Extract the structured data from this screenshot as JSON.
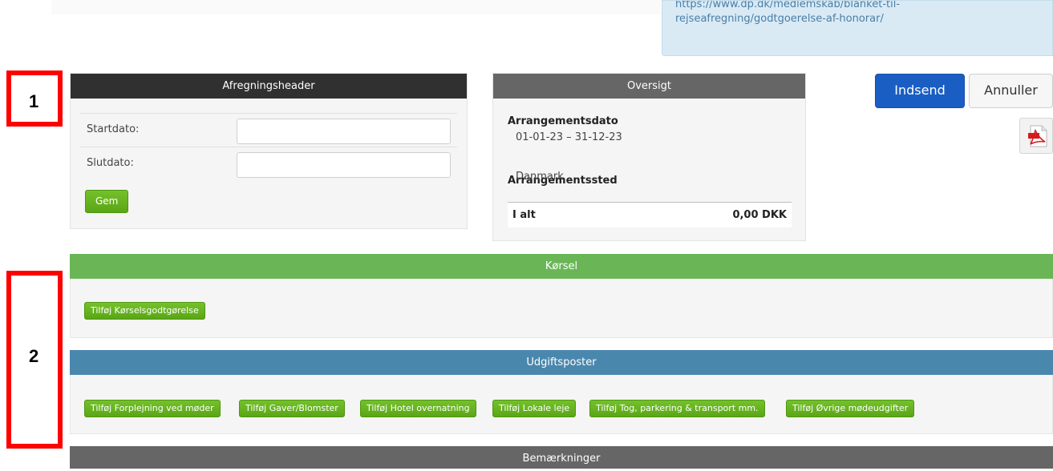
{
  "info": {
    "url_line1": "https://www.dp.dk/medlemskab/blanket-til-",
    "url_line2": "rejseafregning/godtgoerelse-af-honorar/"
  },
  "markers": {
    "one": "1",
    "two": "2"
  },
  "header_panel": {
    "title": "Afregningsheader",
    "start_label": "Startdato:",
    "start_value": "",
    "end_label": "Slutdato:",
    "end_value": "",
    "save_label": "Gem"
  },
  "overview": {
    "title": "Oversigt",
    "date_label": "Arrangementsdato",
    "date_value": "01-01-23 – 31-12-23",
    "place_label": "Arrangementssted",
    "place_value": "Danmark",
    "total_label": "I alt",
    "total_value": "0,00 DKK"
  },
  "actions": {
    "submit_label": "Indsend",
    "cancel_label": "Annuller",
    "pdf_icon": "pdf-icon"
  },
  "korsel": {
    "title": "Kørsel",
    "add_label": "Tilføj Kørselsgodtgørelse"
  },
  "udgifter": {
    "title": "Udgiftsposter",
    "buttons": [
      "Tilføj Forplejning ved møder",
      "Tilføj Gaver/Blomster",
      "Tilføj Hotel overnatning",
      "Tilføj Lokale leje",
      "Tilføj Tog, parkering & transport mm.",
      "Tilføj Øvrige mødeudgifter"
    ]
  },
  "bemaerkninger": {
    "title": "Bemærkninger"
  },
  "colors": {
    "accent_green": "#6ab656",
    "accent_blue": "#4a87ad",
    "primary_button": "#1a5ec4",
    "marker_red": "#ff0000"
  }
}
